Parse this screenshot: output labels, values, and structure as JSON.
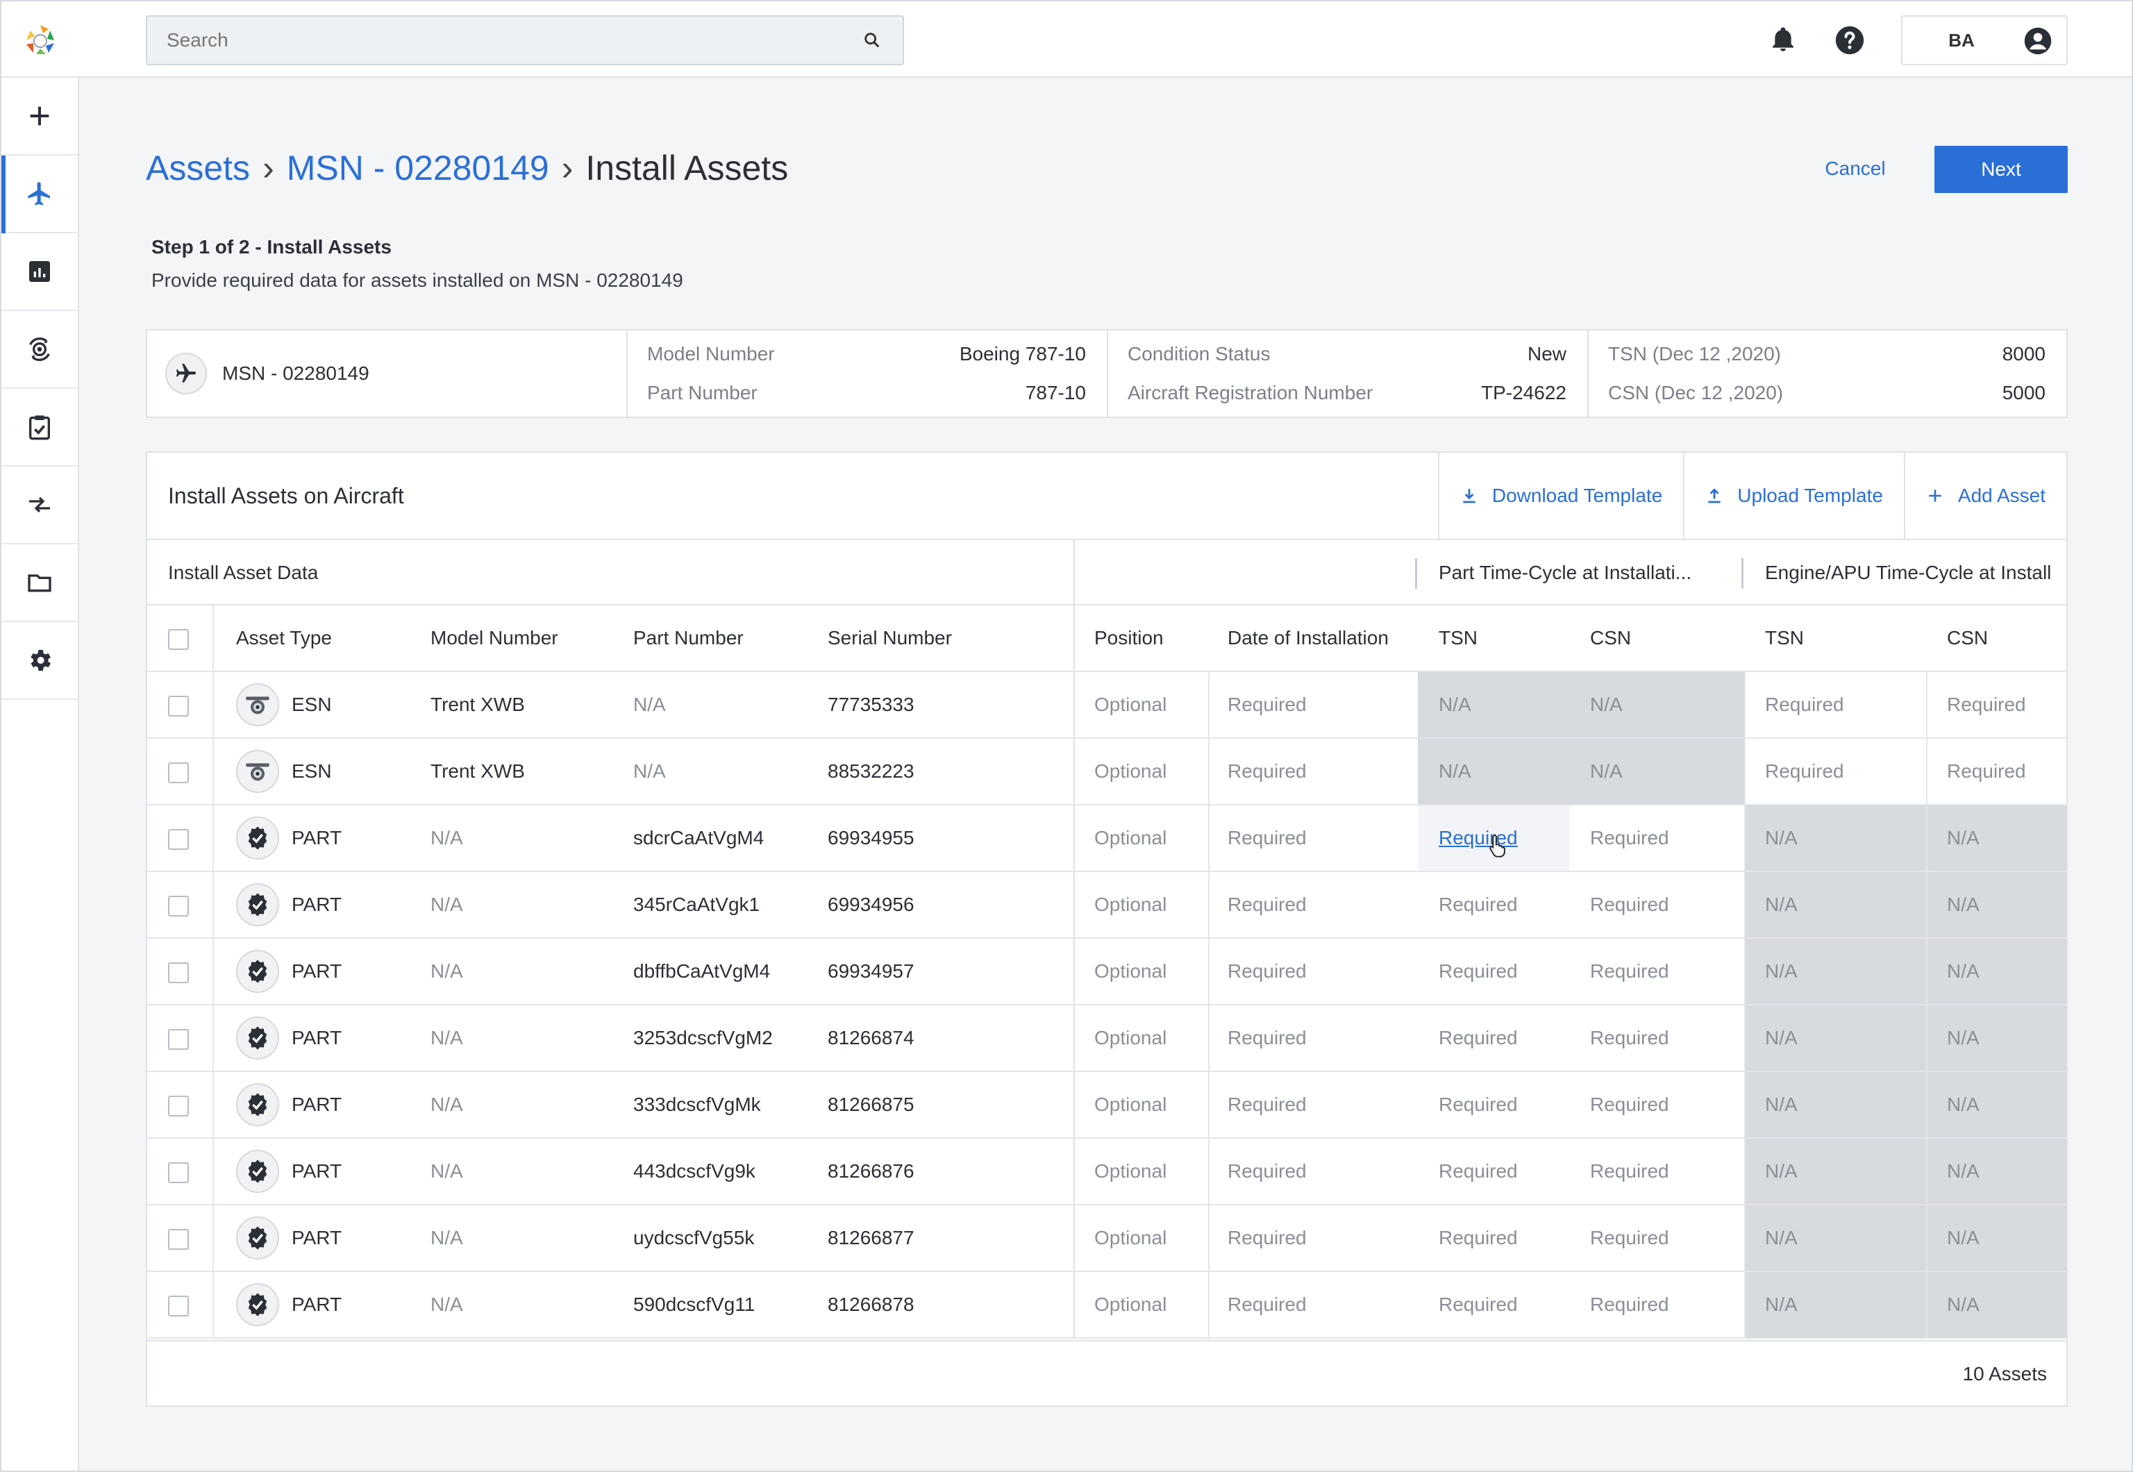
{
  "header": {
    "search_placeholder": "Search",
    "user_initials": "BA",
    "icons": [
      "bell-icon",
      "help-icon",
      "user-avatar-icon",
      "search-icon"
    ]
  },
  "nav": {
    "items": [
      {
        "name": "add",
        "icon": "plus-icon"
      },
      {
        "name": "aircraft",
        "icon": "airplane-icon",
        "active": true
      },
      {
        "name": "reports",
        "icon": "bar-chart-icon"
      },
      {
        "name": "engines",
        "icon": "engine-icon"
      },
      {
        "name": "tasks",
        "icon": "clipboard-check-icon"
      },
      {
        "name": "transfers",
        "icon": "transfer-arrows-icon"
      },
      {
        "name": "files",
        "icon": "folder-icon"
      },
      {
        "name": "settings",
        "icon": "gear-icon"
      }
    ]
  },
  "breadcrumb": {
    "assets": "Assets",
    "msn": "MSN - 02280149",
    "current": "Install Assets",
    "separator": "›"
  },
  "actions": {
    "cancel": "Cancel",
    "next": "Next"
  },
  "step": {
    "title": "Step 1 of 2 - Install Assets",
    "description": "Provide required data for assets installed on MSN - 02280149"
  },
  "summary": {
    "msn": "MSN - 02280149",
    "model_number_label": "Model Number",
    "model_number": "Boeing 787-10",
    "part_number_label": "Part Number",
    "part_number": "787-10",
    "condition_label": "Condition Status",
    "condition": "New",
    "registration_label": "Aircraft Registration Number",
    "registration": "TP-24622",
    "tsn_label": "TSN (Dec 12 ,2020)",
    "tsn": "8000",
    "csn_label": "CSN (Dec 12 ,2020)",
    "csn": "5000"
  },
  "panel": {
    "title": "Install Assets on Aircraft",
    "download": "Download Template",
    "upload": "Upload Template",
    "add": "Add Asset"
  },
  "groups": {
    "install_data": "Install Asset Data",
    "part_tc": "Part Time-Cycle at Installati...",
    "engine_tc": "Engine/APU Time-Cycle at Install"
  },
  "columns": {
    "asset_type": "Asset Type",
    "model_number": "Model Number",
    "part_number": "Part Number",
    "serial_number": "Serial Number",
    "position": "Position",
    "date_install": "Date of Installation",
    "part_tsn": "TSN",
    "part_csn": "CSN",
    "eng_tsn": "TSN",
    "eng_csn": "CSN"
  },
  "rows": [
    {
      "type": "ESN",
      "icon": "engine-icon",
      "model": "Trent XWB",
      "part": "N/A",
      "serial": "77735333",
      "position": "Optional",
      "date": "Required",
      "part_tsn": "N/A",
      "part_csn": "N/A",
      "eng_tsn": "Required",
      "eng_csn": "Required"
    },
    {
      "type": "ESN",
      "icon": "engine-icon",
      "model": "Trent XWB",
      "part": "N/A",
      "serial": "88532223",
      "position": "Optional",
      "date": "Required",
      "part_tsn": "N/A",
      "part_csn": "N/A",
      "eng_tsn": "Required",
      "eng_csn": "Required"
    },
    {
      "type": "PART",
      "icon": "part-icon",
      "model": "N/A",
      "part": "sdcrCaAtVgM4",
      "serial": "69934955",
      "position": "Optional",
      "date": "Required",
      "part_tsn": "Required",
      "part_csn": "Required",
      "eng_tsn": "N/A",
      "eng_csn": "N/A"
    },
    {
      "type": "PART",
      "icon": "part-icon",
      "model": "N/A",
      "part": "345rCaAtVgk1",
      "serial": "69934956",
      "position": "Optional",
      "date": "Required",
      "part_tsn": "Required",
      "part_csn": "Required",
      "eng_tsn": "N/A",
      "eng_csn": "N/A"
    },
    {
      "type": "PART",
      "icon": "part-icon",
      "model": "N/A",
      "part": "dbffbCaAtVgM4",
      "serial": "69934957",
      "position": "Optional",
      "date": "Required",
      "part_tsn": "Required",
      "part_csn": "Required",
      "eng_tsn": "N/A",
      "eng_csn": "N/A"
    },
    {
      "type": "PART",
      "icon": "part-icon",
      "model": "N/A",
      "part": "3253dcscfVgM2",
      "serial": "81266874",
      "position": "Optional",
      "date": "Required",
      "part_tsn": "Required",
      "part_csn": "Required",
      "eng_tsn": "N/A",
      "eng_csn": "N/A"
    },
    {
      "type": "PART",
      "icon": "part-icon",
      "model": "N/A",
      "part": "333dcscfVgMk",
      "serial": "81266875",
      "position": "Optional",
      "date": "Required",
      "part_tsn": "Required",
      "part_csn": "Required",
      "eng_tsn": "N/A",
      "eng_csn": "N/A"
    },
    {
      "type": "PART",
      "icon": "part-icon",
      "model": "N/A",
      "part": "443dcscfVg9k",
      "serial": "81266876",
      "position": "Optional",
      "date": "Required",
      "part_tsn": "Required",
      "part_csn": "Required",
      "eng_tsn": "N/A",
      "eng_csn": "N/A"
    },
    {
      "type": "PART",
      "icon": "part-icon",
      "model": "N/A",
      "part": "uydcscfVg55k",
      "serial": "81266877",
      "position": "Optional",
      "date": "Required",
      "part_tsn": "Required",
      "part_csn": "Required",
      "eng_tsn": "N/A",
      "eng_csn": "N/A"
    },
    {
      "type": "PART",
      "icon": "part-icon",
      "model": "N/A",
      "part": "590dcscfVg11",
      "serial": "81266878",
      "position": "Optional",
      "date": "Required",
      "part_tsn": "Required",
      "part_csn": "Required",
      "eng_tsn": "N/A",
      "eng_csn": "N/A"
    }
  ],
  "footer": {
    "count": "10 Assets"
  },
  "colors": {
    "accent": "#2a6fd6",
    "disabled_cell": "#d7dadf"
  }
}
